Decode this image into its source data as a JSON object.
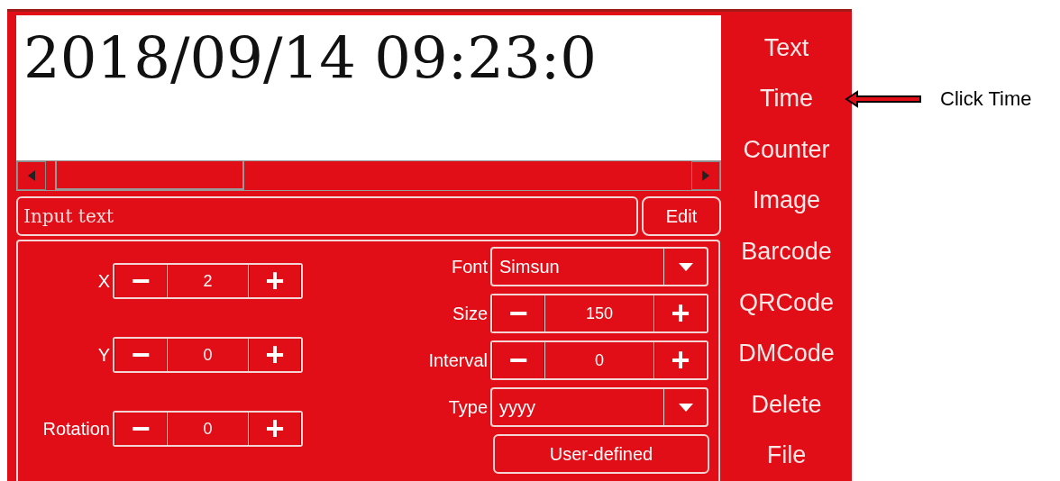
{
  "preview": {
    "text": "2018/09/14 09:23:0"
  },
  "input": {
    "placeholder": "Input text",
    "button": "Edit"
  },
  "left_params": [
    {
      "label": "X",
      "value": "2",
      "minus": "−",
      "plus": "+"
    },
    {
      "label": "Y",
      "value": "0",
      "minus": "−",
      "plus": "+"
    },
    {
      "label": "Rotation",
      "value": "0",
      "minus": "−",
      "plus": "+"
    }
  ],
  "right_params": [
    {
      "kind": "dropdown",
      "label": "Font",
      "value": "Simsun"
    },
    {
      "kind": "stepper",
      "label": "Size",
      "value": "150"
    },
    {
      "kind": "stepper",
      "label": "Interval",
      "value": "0"
    },
    {
      "kind": "dropdown",
      "label": "Type",
      "value": "yyyy"
    },
    {
      "kind": "button",
      "label": "User-defined"
    }
  ],
  "menu": [
    "Text",
    "Time",
    "Counter",
    "Image",
    "Barcode",
    "QRCode",
    "DMCode",
    "Delete",
    "File"
  ],
  "annotation": {
    "text": "Click Time"
  }
}
